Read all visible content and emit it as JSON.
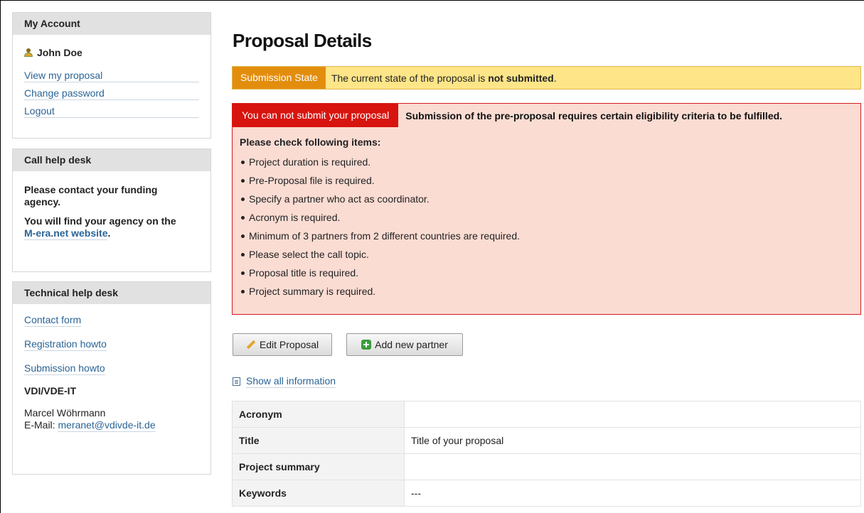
{
  "sidebar": {
    "account": {
      "heading": "My Account",
      "user_name": "John Doe",
      "links": [
        "View my proposal",
        "Change password",
        "Logout"
      ]
    },
    "call_help": {
      "heading": "Call help desk",
      "line1": "Please contact your funding agency.",
      "line2_prefix": "You will find your agency on the",
      "link": "M-era.net website",
      "line2_suffix": "."
    },
    "tech_help": {
      "heading": "Technical help desk",
      "links": [
        "Contact form",
        "Registration howto",
        "Submission howto"
      ],
      "org": "VDI/VDE-IT",
      "contact_name": "Marcel Wöhrmann",
      "email_label": "E-Mail:",
      "email": "meranet@vdivde-it.de"
    }
  },
  "main": {
    "title": "Proposal Details",
    "state": {
      "tag": "Submission State",
      "message_prefix": "The current state of the proposal is",
      "status": "not submitted",
      "message_suffix": "."
    },
    "error": {
      "tag": "You can not submit your proposal",
      "message": "Submission of the pre-proposal requires certain eligibility criteria to be fulfilled.",
      "check_heading": "Please check following items:",
      "items": [
        "Project duration is required.",
        "Pre-Proposal file is required.",
        "Specify a partner who act as coordinator.",
        "Acronym is required.",
        "Minimum of 3 partners from 2 different countries are required.",
        "Please select the call topic.",
        "Proposal title is required.",
        "Project summary is required."
      ]
    },
    "buttons": {
      "edit": "Edit Proposal",
      "add_partner": "Add new partner"
    },
    "show_all": "Show all information",
    "table": [
      {
        "key": "Acronym",
        "value": ""
      },
      {
        "key": "Title",
        "value": "Title of your proposal"
      },
      {
        "key": "Project summary",
        "value": ""
      },
      {
        "key": "Keywords",
        "value": "---"
      }
    ]
  }
}
